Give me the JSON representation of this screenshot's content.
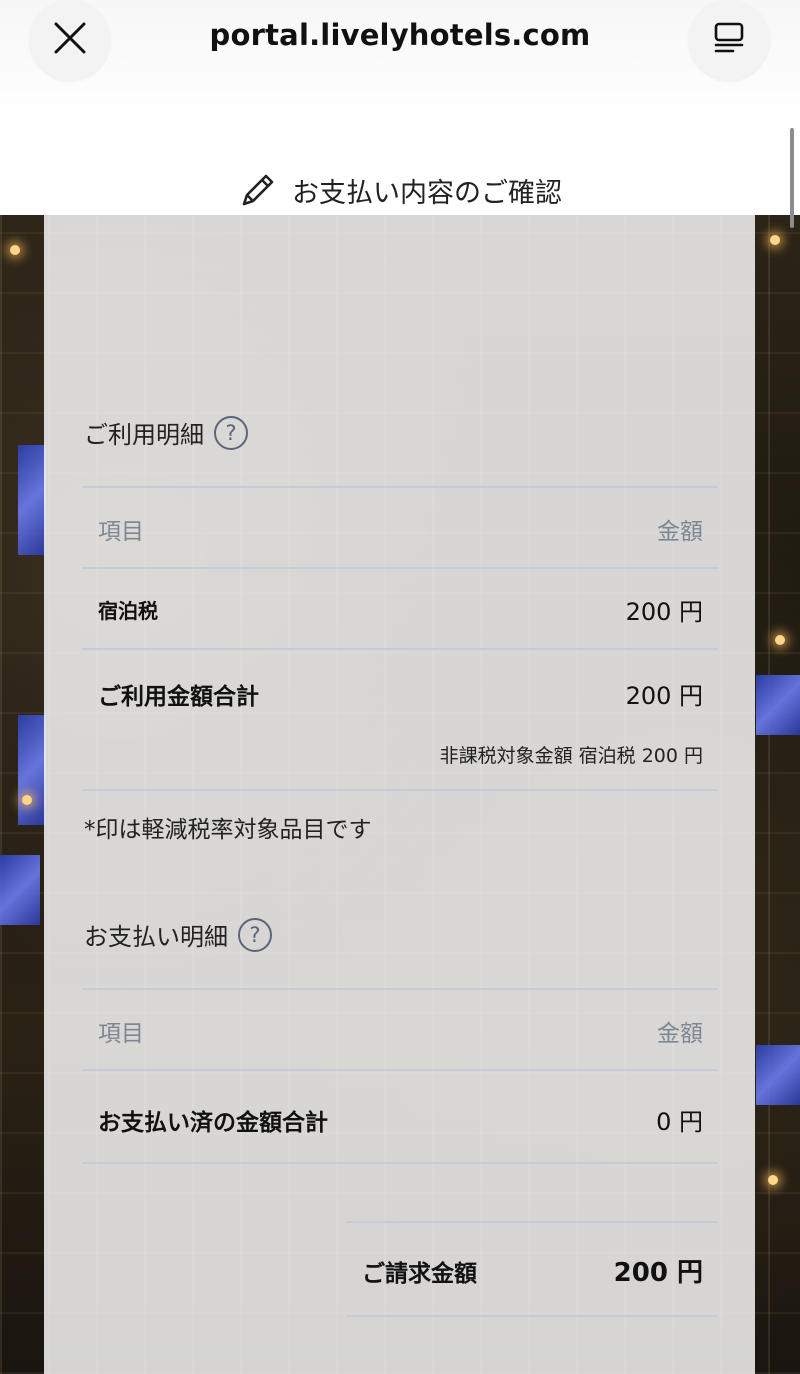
{
  "browser": {
    "url": "portal.livelyhotels.com"
  },
  "page": {
    "heading": "お支払い内容のご確認"
  },
  "usage": {
    "title": "ご利用明細",
    "help_glyph": "?",
    "header_item": "項目",
    "header_amount": "金額",
    "rows": [
      {
        "label": "宿泊税",
        "amount": "200 円"
      }
    ],
    "total_label": "ご利用金額合計",
    "total_amount": "200 円",
    "tax_note": "非課税対象金額 宿泊税 200 円"
  },
  "reduced_tax_note": "*印は軽減税率対象品目です",
  "payment": {
    "title": "お支払い明細",
    "help_glyph": "?",
    "header_item": "項目",
    "header_amount": "金額",
    "paid_total_label": "お支払い済の金額合計",
    "paid_total_amount": "0 円"
  },
  "billing": {
    "label": "ご請求金額",
    "amount": "200 円"
  },
  "icons": {
    "close": "close-icon",
    "menu": "menu-icon",
    "edit": "pencil-icon",
    "help": "help-icon"
  }
}
